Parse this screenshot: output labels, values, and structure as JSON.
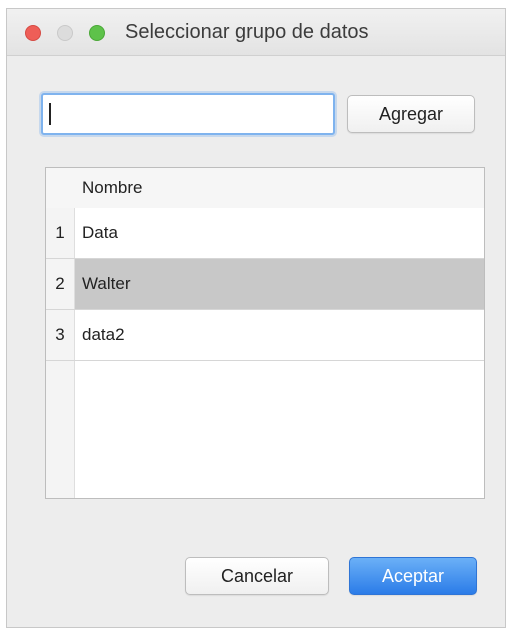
{
  "window": {
    "title": "Seleccionar grupo de datos"
  },
  "form": {
    "input_value": "",
    "add_label": "Agregar"
  },
  "table": {
    "column_header": "Nombre",
    "rows": [
      {
        "index": "1",
        "name": "Data",
        "selected": false
      },
      {
        "index": "2",
        "name": "Walter",
        "selected": true
      },
      {
        "index": "3",
        "name": "data2",
        "selected": false
      }
    ]
  },
  "footer": {
    "cancel_label": "Cancelar",
    "accept_label": "Aceptar"
  },
  "colors": {
    "accent": "#2b7ce8",
    "selection": "#c8c8c8",
    "close": "#ee5e57",
    "zoom": "#5ec24a"
  }
}
